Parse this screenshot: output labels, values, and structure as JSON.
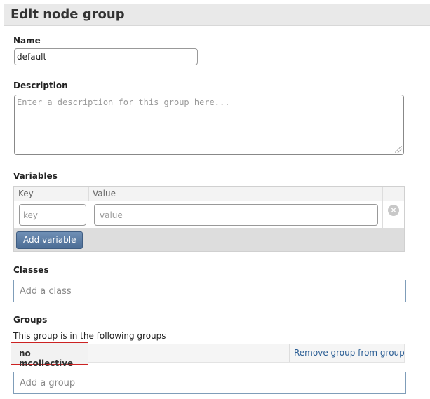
{
  "page": {
    "title": "Edit node group"
  },
  "name_field": {
    "label": "Name",
    "value": "default"
  },
  "description_field": {
    "label": "Description",
    "placeholder": "Enter a description for this group here..."
  },
  "variables": {
    "label": "Variables",
    "columns": [
      "Key",
      "Value"
    ],
    "key_placeholder": "key",
    "value_placeholder": "value",
    "add_button": "Add variable",
    "remove_icon": "remove-circle-icon"
  },
  "classes": {
    "label": "Classes",
    "placeholder": "Add a class"
  },
  "groups": {
    "label": "Groups",
    "description": "This group is in the following groups",
    "items": [
      {
        "name": "no mcollective",
        "action": "Remove group from group"
      }
    ],
    "placeholder": "Add a group"
  },
  "colors": {
    "highlight_border": "#cc2222",
    "button": "#5a7ba3",
    "link": "#2b5e95"
  }
}
